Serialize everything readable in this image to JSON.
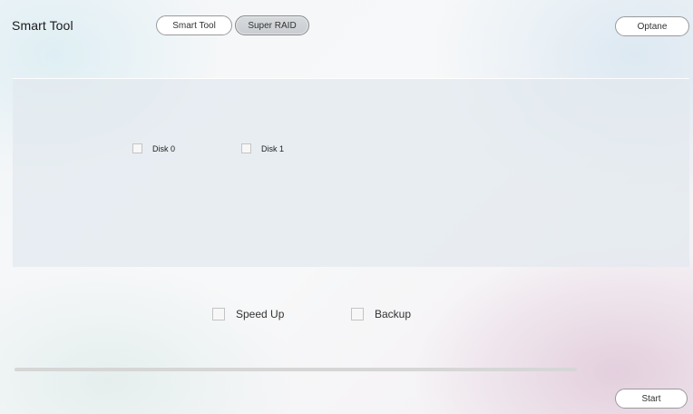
{
  "app": {
    "title": "Smart Tool"
  },
  "tabs": [
    {
      "label": "Smart Tool",
      "selected": false
    },
    {
      "label": "Super RAID",
      "selected": true
    }
  ],
  "header": {
    "optane_label": "Optane"
  },
  "disks": [
    {
      "label": "Disk 0",
      "checked": false
    },
    {
      "label": "Disk 1",
      "checked": false
    }
  ],
  "options": [
    {
      "label": "Speed Up",
      "checked": false
    },
    {
      "label": "Backup",
      "checked": false
    }
  ],
  "progress": {
    "fraction": 0
  },
  "footer": {
    "start_label": "Start"
  },
  "colors": {
    "selected_tab": "#cfd3d7",
    "panel": "#e2e9ee",
    "progress_track": "#d6d6d6"
  }
}
